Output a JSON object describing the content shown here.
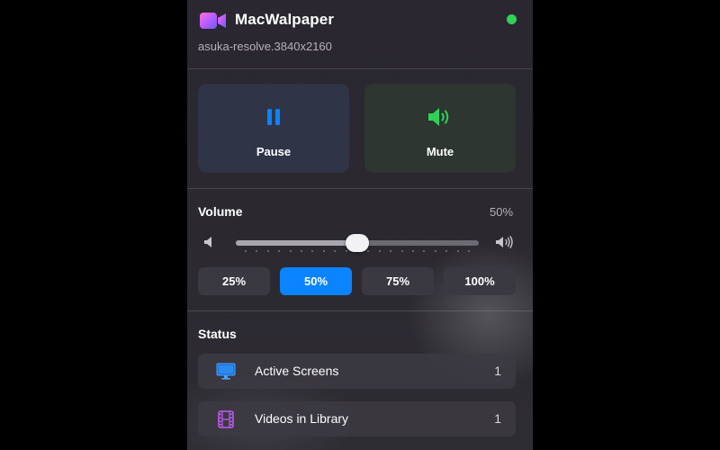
{
  "app": {
    "title": "MacWalpaper",
    "subtitle": "asuka-resolve.3840x2160",
    "status_color": "#30d158",
    "icon": "video-camera-icon"
  },
  "controls": {
    "pause_label": "Pause",
    "pause_icon": "pause-icon",
    "mute_label": "Mute",
    "mute_icon": "speaker-icon"
  },
  "volume": {
    "title": "Volume",
    "value_label": "50%",
    "level": 0.5,
    "presets": [
      {
        "label": "25%",
        "active": false
      },
      {
        "label": "50%",
        "active": true
      },
      {
        "label": "75%",
        "active": false
      },
      {
        "label": "100%",
        "active": false
      }
    ]
  },
  "status": {
    "title": "Status",
    "rows": [
      {
        "label": "Active Screens",
        "count": "1",
        "icon": "monitor-icon"
      },
      {
        "label": "Videos in Library",
        "count": "1",
        "icon": "film-icon"
      }
    ]
  },
  "colors": {
    "accent": "#0a84ff",
    "pause_icon": "#0a84ff",
    "mute_icon": "#30d158",
    "monitor_icon": "#1e88e5",
    "film_icon": "#bf5af2"
  }
}
